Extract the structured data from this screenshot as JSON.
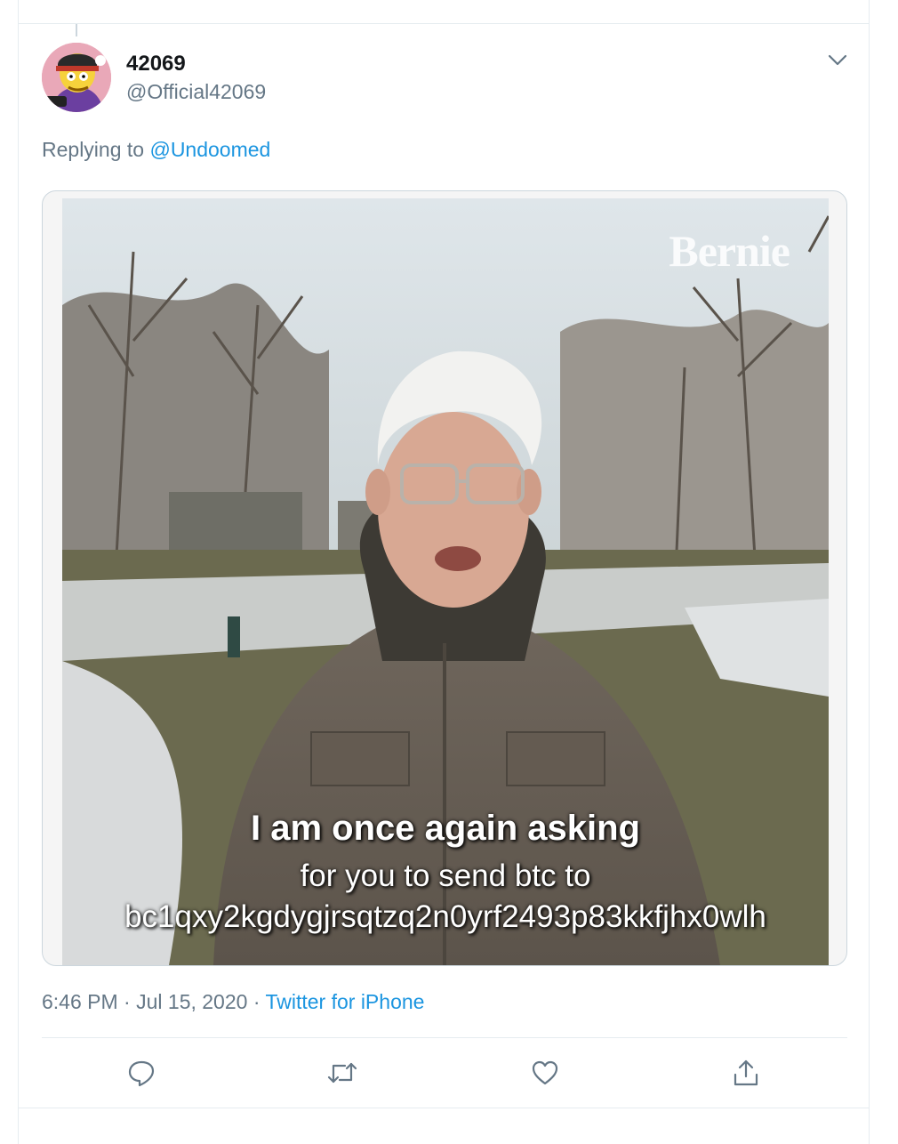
{
  "tweet": {
    "display_name": "42069",
    "handle": "@Official42069",
    "reply_prefix": "Replying to ",
    "reply_to": "@Undoomed",
    "time": "6:46 PM",
    "separator": " · ",
    "date": "Jul 15, 2020",
    "source": "Twitter for iPhone"
  },
  "media": {
    "watermark": "Bernie",
    "caption_line1": "I am once again asking",
    "caption_line2": "for you to send btc to",
    "caption_line3": "bc1qxy2kgdygjrsqtzq2n0yrf2493p83kkfjhx0wlh"
  },
  "icons": {
    "more": "chevron-down-icon",
    "reply": "reply-icon",
    "retweet": "retweet-icon",
    "like": "like-icon",
    "share": "share-icon"
  },
  "colors": {
    "link": "#1b95e0",
    "secondary_text": "#657786",
    "primary_text": "#14171a",
    "border": "#e6ecf0"
  }
}
